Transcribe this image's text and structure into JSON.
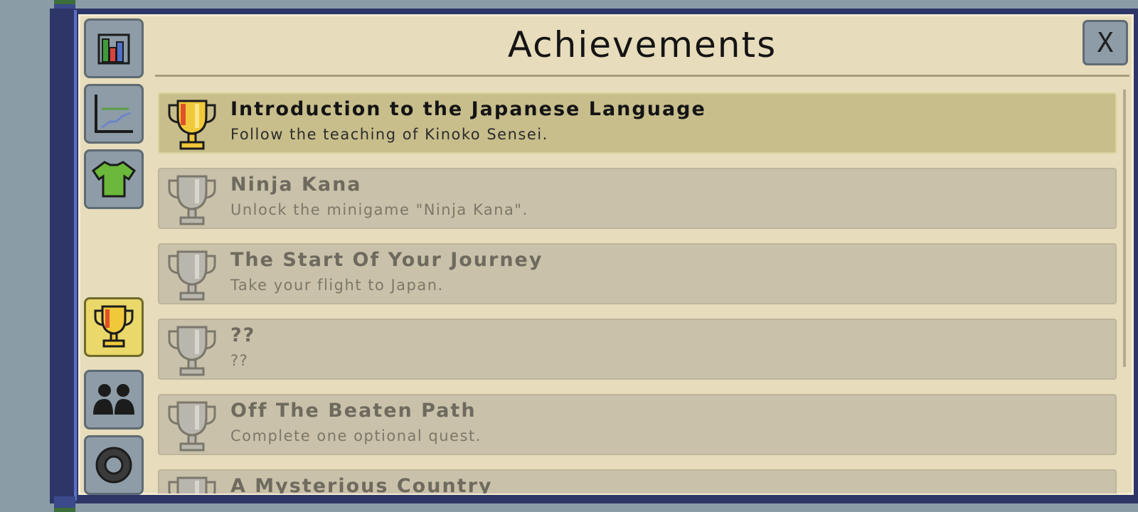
{
  "window": {
    "title": "Achievements",
    "close_label": "X"
  },
  "side_tabs": [
    {
      "name": "stats-tab",
      "icon": "bar-chart-icon",
      "active": false
    },
    {
      "name": "progress-tab",
      "icon": "line-graph-icon",
      "active": false
    },
    {
      "name": "outfit-tab",
      "icon": "shirt-icon",
      "active": false
    },
    {
      "name": "achievements-tab",
      "icon": "trophy-icon",
      "active": true
    },
    {
      "name": "friends-tab",
      "icon": "people-icon",
      "active": false
    },
    {
      "name": "settings-tab",
      "icon": "gear-icon",
      "active": false
    }
  ],
  "achievements": [
    {
      "name": "Introduction to the Japanese Language",
      "desc": "Follow the teaching of Kinoko Sensei.",
      "unlocked": true
    },
    {
      "name": "Ninja Kana",
      "desc": "Unlock the minigame \"Ninja Kana\".",
      "unlocked": false
    },
    {
      "name": "The Start Of Your Journey",
      "desc": "Take your flight to Japan.",
      "unlocked": false
    },
    {
      "name": "??",
      "desc": "??",
      "unlocked": false
    },
    {
      "name": "Off The Beaten Path",
      "desc": "Complete one optional quest.",
      "unlocked": false
    },
    {
      "name": "A Mysterious Country",
      "desc": "",
      "unlocked": false
    }
  ],
  "colors": {
    "gold": "#f0c93a",
    "locked_trophy": "#b9b6ad",
    "frame": "#2e3668",
    "paper": "#e7dcbb"
  }
}
